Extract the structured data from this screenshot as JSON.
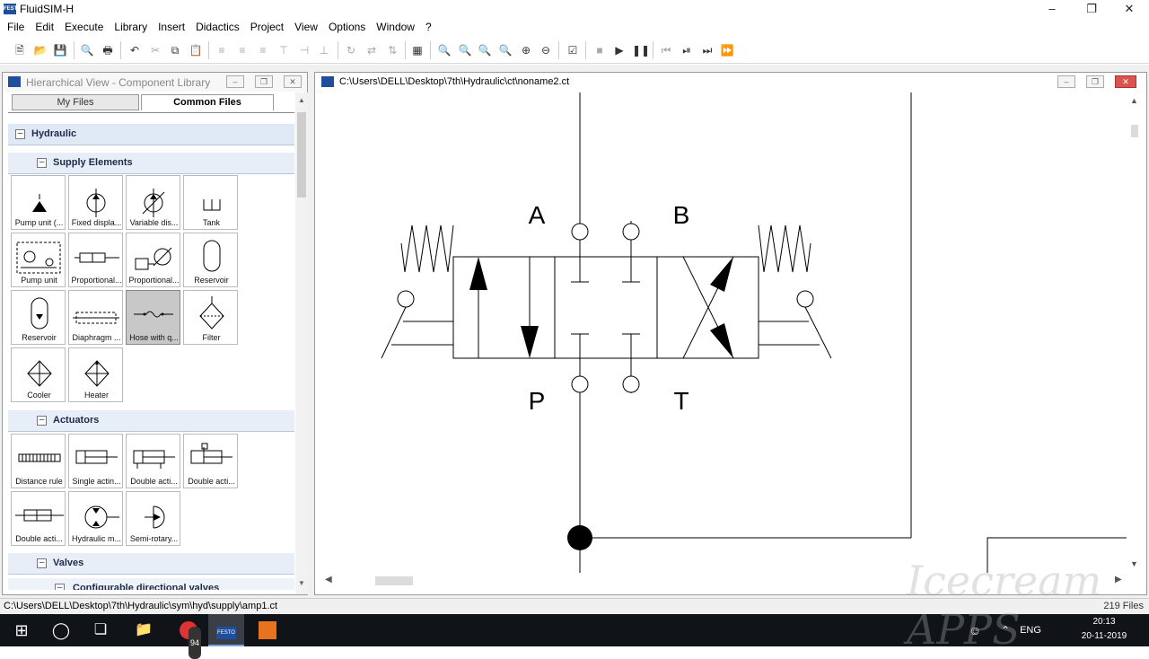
{
  "app": {
    "title": "FluidSIM-H",
    "logo_text": "FESTO"
  },
  "menu": [
    "File",
    "Edit",
    "Execute",
    "Library",
    "Insert",
    "Didactics",
    "Project",
    "View",
    "Options",
    "Window",
    "?"
  ],
  "library": {
    "title": "Hierarchical View - Component Library",
    "tabs": [
      "My Files",
      "Common Files"
    ],
    "hydraulic_label": "Hydraulic",
    "supply_label": "Supply Elements",
    "supply_items": [
      "Pump unit (...",
      "Fixed displa...",
      "Variable dis...",
      "Tank",
      "Pump unit",
      "Proportional...",
      "Proportional...",
      "Reservoir",
      "Reservoir",
      "Diaphragm ...",
      "Hose with q...",
      "Filter",
      "Cooler",
      "Heater"
    ],
    "actuators_label": "Actuators",
    "actuator_items": [
      "Distance rule",
      "Single actin...",
      "Double acti...",
      "Double acti...",
      "Double acti...",
      "Hydraulic m...",
      "Semi-rotary..."
    ],
    "valves_label": "Valves",
    "configurable_label": "Configurable directional valves"
  },
  "circuit": {
    "path": "C:\\Users\\DELL\\Desktop\\7th\\Hydraulic\\ct\\noname2.ct",
    "ports": {
      "a": "A",
      "b": "B",
      "p": "P",
      "t": "T"
    }
  },
  "status": {
    "path": "C:\\Users\\DELL\\Desktop\\7th\\Hydraulic\\sym\\hyd\\supply\\amp1.ct",
    "files": "219 Files"
  },
  "taskbar": {
    "lang": "ENG",
    "time": "20:13",
    "date": "20-11-2019",
    "badge": "94"
  },
  "watermark": "Icecream APPS"
}
